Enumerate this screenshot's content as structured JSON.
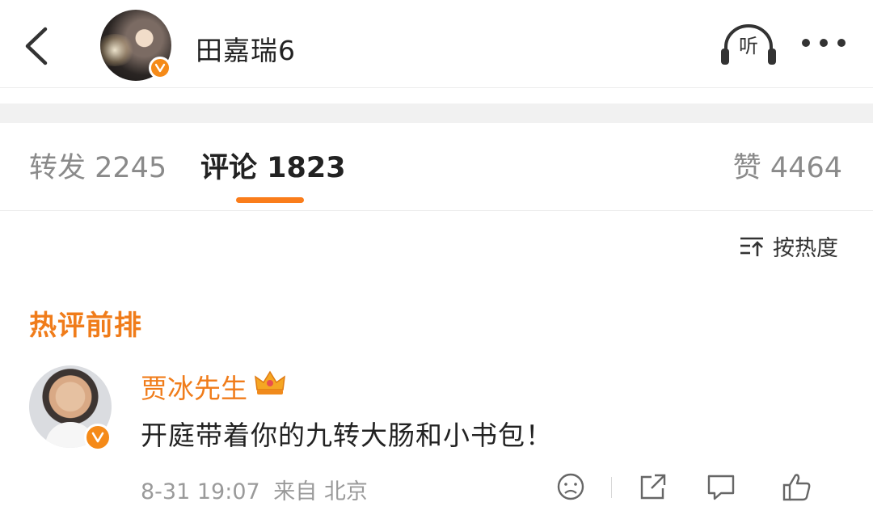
{
  "header": {
    "user_name": "田嘉瑞6",
    "listen_label": "听"
  },
  "tabs": {
    "repost": "转发 2245",
    "comment": "评论 1823",
    "like": "赞 4464"
  },
  "sort": {
    "label": "按热度"
  },
  "hot_section": {
    "title": "热评前排"
  },
  "comment": {
    "author": "贾冰先生",
    "text": "开庭带着你的九转大肠和小书包！",
    "time": "8-31 19:07",
    "source": "来自 北京"
  },
  "colors": {
    "accent": "#fa7d1b",
    "verify": "#f58a18"
  },
  "icons": [
    "back-arrow-icon",
    "verified-badge-icon",
    "headphones-icon",
    "more-dots-icon",
    "sort-icon",
    "crown-icon",
    "emoji-icon",
    "share-icon",
    "reply-icon",
    "like-icon"
  ]
}
